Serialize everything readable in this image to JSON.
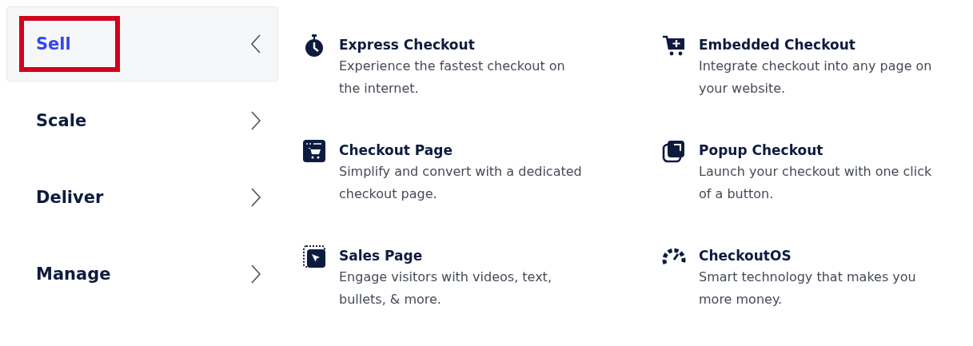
{
  "menu": [
    {
      "label": "Sell",
      "selected": true,
      "highlighted": true
    },
    {
      "label": "Scale",
      "selected": false,
      "highlighted": false
    },
    {
      "label": "Deliver",
      "selected": false,
      "highlighted": false
    },
    {
      "label": "Manage",
      "selected": false,
      "highlighted": false
    }
  ],
  "products": [
    {
      "kind": "stopwatch",
      "title": "Express Checkout",
      "description": "Experience the fastest checkout on the internet."
    },
    {
      "kind": "cart-plus",
      "title": "Embedded Checkout",
      "description": "Integrate checkout into any page on your website."
    },
    {
      "kind": "page-cart",
      "title": "Checkout Page",
      "description": "Simplify and convert with a dedicated checkout page."
    },
    {
      "kind": "popup",
      "title": "Popup Checkout",
      "description": "Launch your checkout with one click of a button."
    },
    {
      "kind": "cursor-page",
      "title": "Sales Page",
      "description": "Engage visitors with videos, text, bullets, & more."
    },
    {
      "kind": "gauge",
      "title": "CheckoutOS",
      "description": "Smart technology that makes you more money."
    }
  ]
}
